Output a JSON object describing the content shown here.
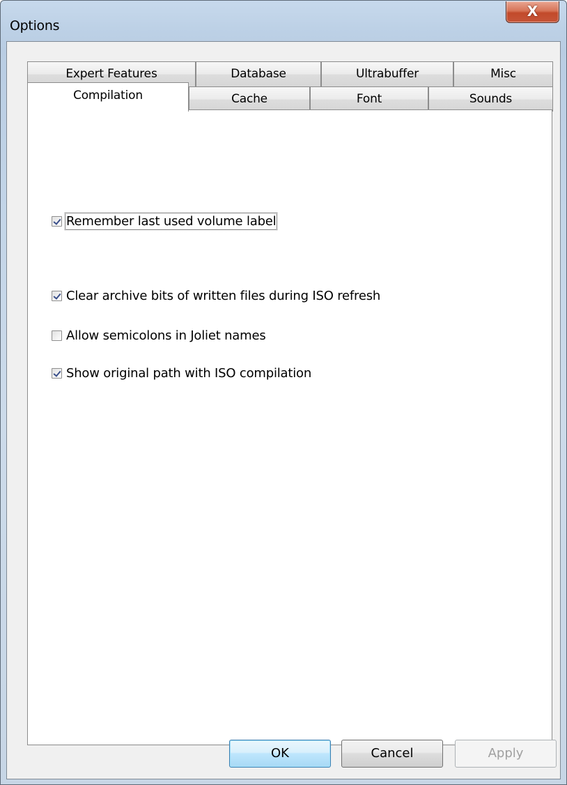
{
  "window": {
    "title": "Options",
    "close_glyph": "X"
  },
  "tabs_row1": [
    "Expert Features",
    "Database",
    "Ultrabuffer",
    "Misc"
  ],
  "tabs_row2": [
    "Compilation",
    "Cache",
    "Font",
    "Sounds"
  ],
  "active_tab": "Compilation",
  "options": [
    {
      "label": "Remember last used volume label",
      "checked": true
    },
    {
      "label": "Clear archive bits of written files during ISO refresh",
      "checked": true
    },
    {
      "label": "Allow semicolons in Joliet names",
      "checked": false
    },
    {
      "label": "Show original path with ISO compilation",
      "checked": true
    }
  ],
  "buttons": {
    "ok": "OK",
    "cancel": "Cancel",
    "apply": "Apply"
  }
}
